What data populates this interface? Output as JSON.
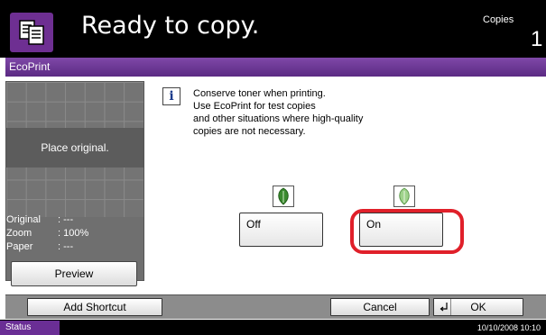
{
  "header": {
    "title": "Ready to copy.",
    "copies_label": "Copies",
    "copies_value": "1",
    "app_icon": "copy-document-icon"
  },
  "screen": {
    "title": "EcoPrint"
  },
  "preview": {
    "placeholder": "Place original.",
    "original_label": "Original",
    "original_value": ":  ---",
    "zoom_label": "Zoom",
    "zoom_value": ":  100%",
    "paper_label": "Paper",
    "paper_value": ":  ---",
    "preview_button": "Preview"
  },
  "message": {
    "icon": "info-icon",
    "lines": [
      "Conserve toner when printing.",
      "Use EcoPrint for test copies",
      "and other situations where high-quality",
      "copies are not necessary."
    ]
  },
  "options": {
    "off_label": "Off",
    "on_label": "On",
    "selected": "On",
    "off_icon": "leaf-dark-icon",
    "on_icon": "leaf-light-icon"
  },
  "bottom": {
    "add_shortcut": "Add Shortcut",
    "cancel": "Cancel",
    "ok": "OK",
    "ok_icon": "enter-arrow-icon"
  },
  "status": {
    "label": "Status",
    "datetime": "10/10/2008   10:10"
  },
  "colors": {
    "brand_purple": "#6a2e95",
    "highlight_red": "#e0202a",
    "leaf_dark": "#3a8a2e",
    "leaf_light": "#9fd38c"
  }
}
